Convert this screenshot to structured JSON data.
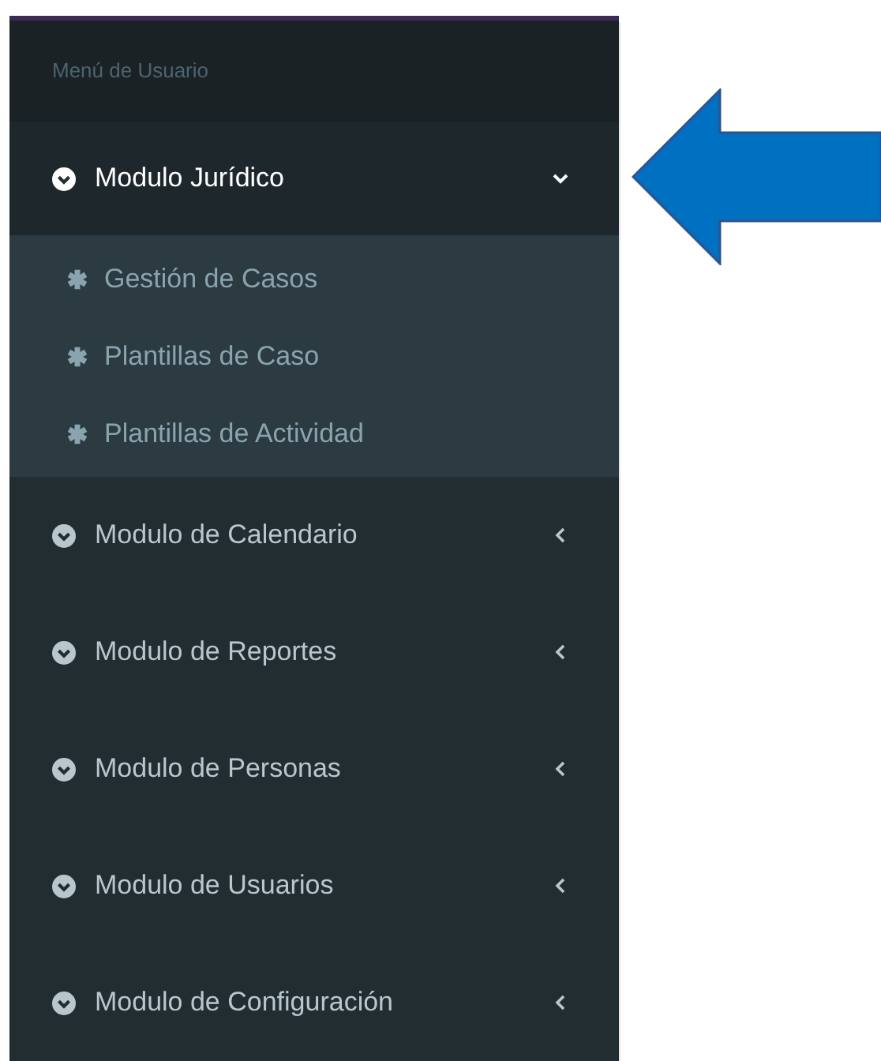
{
  "sidebar": {
    "header": "Menú de Usuario",
    "modules": [
      {
        "label": "Modulo Jurídico",
        "expanded": true,
        "children": [
          {
            "label": "Gestión de Casos"
          },
          {
            "label": "Plantillas de Caso"
          },
          {
            "label": "Plantillas de Actividad"
          }
        ]
      },
      {
        "label": "Modulo de Calendario",
        "expanded": false
      },
      {
        "label": "Modulo de Reportes",
        "expanded": false
      },
      {
        "label": "Modulo de Personas",
        "expanded": false
      },
      {
        "label": "Modulo de Usuarios",
        "expanded": false
      },
      {
        "label": "Modulo de Configuración",
        "expanded": false
      }
    ]
  }
}
